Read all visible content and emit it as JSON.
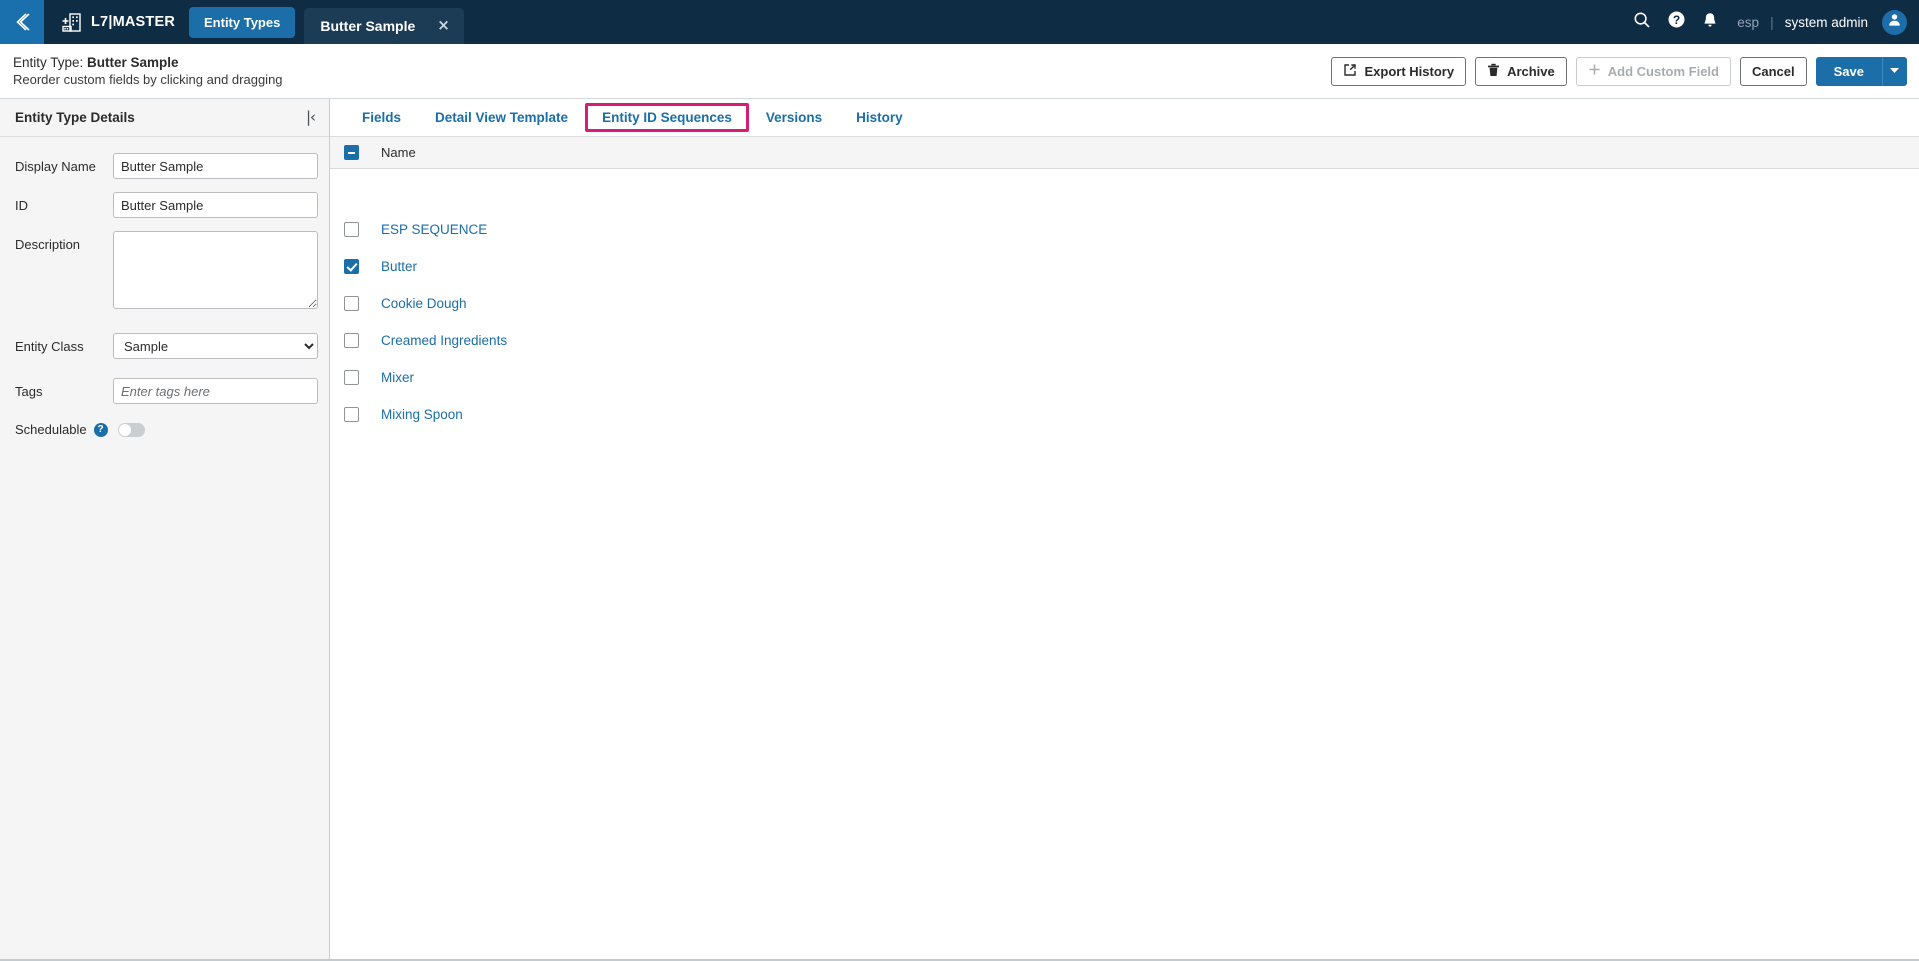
{
  "topnav": {
    "collapse_icon": "chevron-left-icon",
    "app_icon": "building-app-icon",
    "brand": "L7|MASTER",
    "nav_pill": "Entity Types",
    "open_tab": "Butter Sample",
    "tab_close": "×",
    "search_icon": "search-icon",
    "help_icon": "help-circle-icon",
    "notifications_icon": "bell-icon",
    "org": "esp",
    "separator": "|",
    "username": "system admin",
    "avatar_icon": "user-avatar-icon",
    "colors": {
      "bar_bg": "#0f2c45",
      "collapse_bg": "#1a6fad",
      "pill_bg": "#1b6ea8",
      "tab_bg": "#1c3b55"
    }
  },
  "pagehead": {
    "title_prefix": "Entity Type: ",
    "title_value": "Butter Sample",
    "subtitle": "Reorder custom fields by clicking and dragging",
    "actions": {
      "export_history": "Export History",
      "export_icon": "external-link-icon",
      "archive": "Archive",
      "archive_icon": "trash-icon",
      "add_custom_field": "Add Custom Field",
      "add_icon": "plus-icon",
      "cancel": "Cancel",
      "save": "Save",
      "save_dropdown_icon": "caret-down-icon"
    }
  },
  "sidebar": {
    "title": "Entity Type Details",
    "collapse_icon": "collapse-panel-icon",
    "collapse_glyph": "|‹",
    "fields": {
      "display_name_label": "Display Name",
      "display_name_value": "Butter Sample",
      "id_label": "ID",
      "id_value": "Butter Sample",
      "description_label": "Description",
      "description_value": "",
      "entity_class_label": "Entity Class",
      "entity_class_value": "Sample",
      "entity_class_options": [
        "Sample"
      ],
      "tags_label": "Tags",
      "tags_value": "",
      "tags_placeholder": "Enter tags here",
      "schedulable_label": "Schedulable",
      "schedulable_help": "?",
      "schedulable_on": false
    }
  },
  "main": {
    "tabs": [
      {
        "label": "Fields",
        "highlighted": false
      },
      {
        "label": "Detail View Template",
        "highlighted": false
      },
      {
        "label": "Entity ID Sequences",
        "highlighted": true
      },
      {
        "label": "Versions",
        "highlighted": false
      },
      {
        "label": "History",
        "highlighted": false
      }
    ],
    "highlight_color": "#d81b74",
    "list": {
      "header_checkbox_state": "indeterminate",
      "column_header": "Name",
      "rows": [
        {
          "name": "ESP SEQUENCE",
          "checked": false
        },
        {
          "name": "Butter",
          "checked": true
        },
        {
          "name": "Cookie Dough",
          "checked": false
        },
        {
          "name": "Creamed Ingredients",
          "checked": false
        },
        {
          "name": "Mixer",
          "checked": false
        },
        {
          "name": "Mixing Spoon",
          "checked": false
        }
      ]
    }
  }
}
